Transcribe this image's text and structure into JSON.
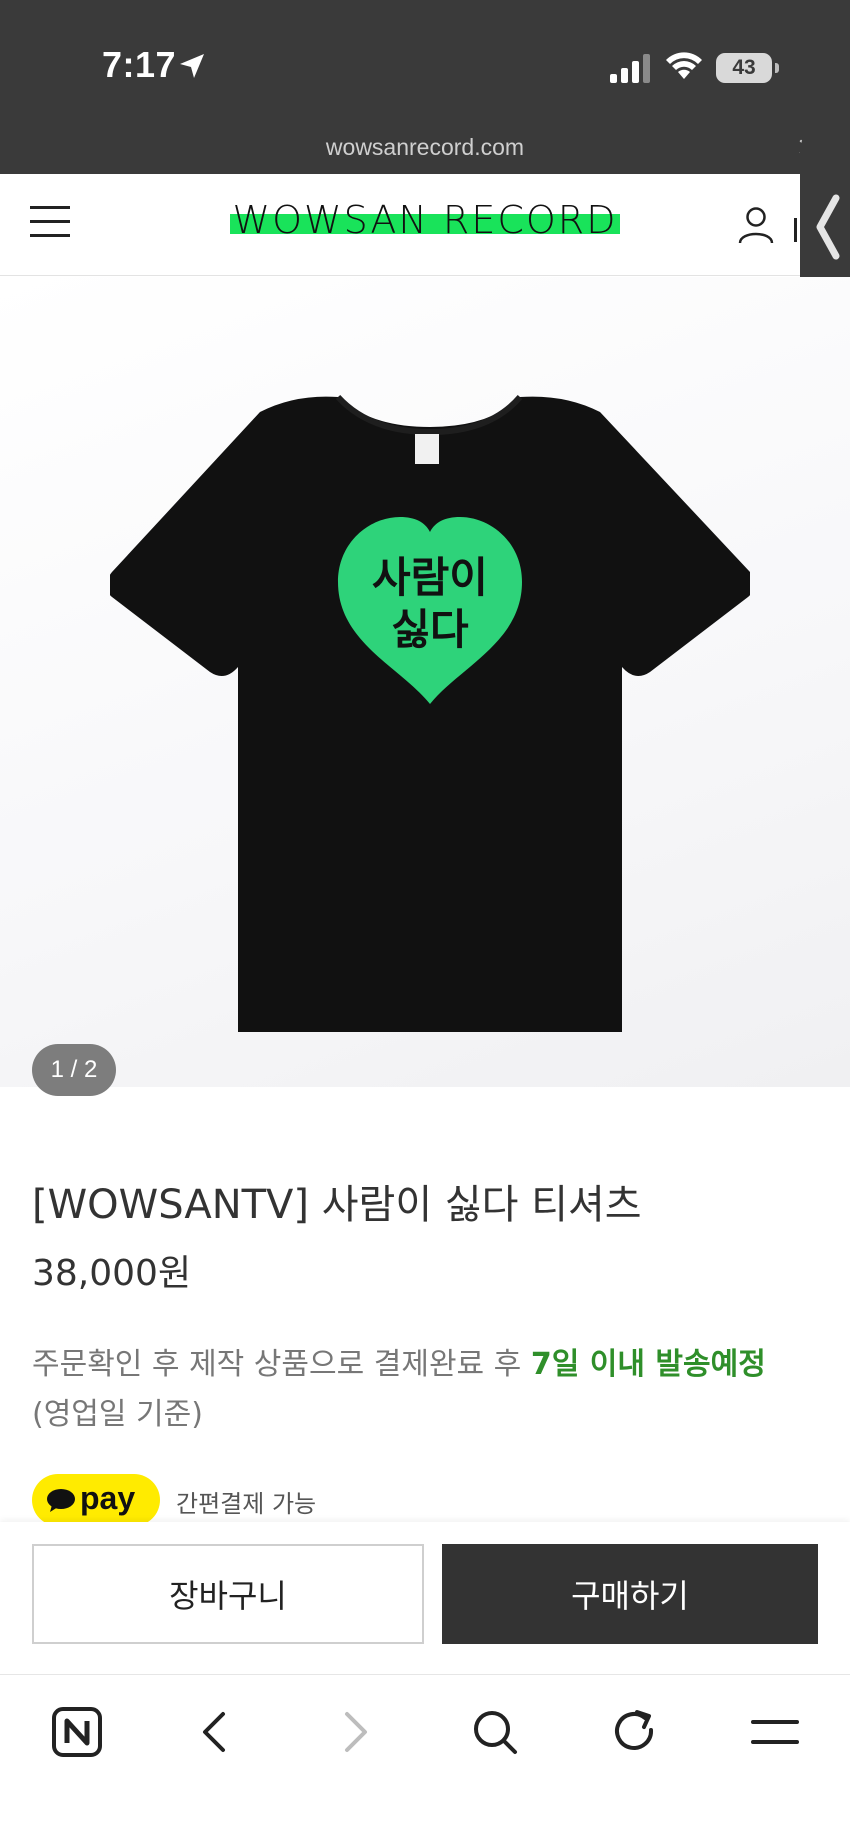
{
  "status_bar": {
    "time": "7:17",
    "battery": "43"
  },
  "browser": {
    "url": "wowsanrecord.com",
    "close_glyph": "×"
  },
  "header": {
    "logo_text": "WOWSAN RECORD",
    "logo_accent_color": "#19e35a",
    "menu_icon": "hamburger-menu-icon",
    "account_icon": "user-icon"
  },
  "product": {
    "image_alt_text": "사람이 싫다",
    "heart_color": "#2ed37a",
    "slide_counter": "1 / 2",
    "title": "[WOWSANTV] 사람이 싫다 티셔츠",
    "price": "38,000원",
    "shipping_note_prefix": "주문확인 후 제작 상품으로 결제완료 후 ",
    "shipping_note_highlight": "7일 이내 발송예정",
    "shipping_note_suffix": "(영업일 기준)",
    "shipping_highlight_color": "#2f8f2a",
    "kakaopay_label": "pay",
    "kakaopay_caption": "간편결제 가능"
  },
  "actions": {
    "cart_label": "장바구니",
    "buy_label": "구매하기"
  },
  "toolbar": {
    "items": [
      "naver-home-icon",
      "back-icon",
      "forward-icon",
      "search-icon",
      "reload-icon",
      "menu-icon"
    ]
  }
}
